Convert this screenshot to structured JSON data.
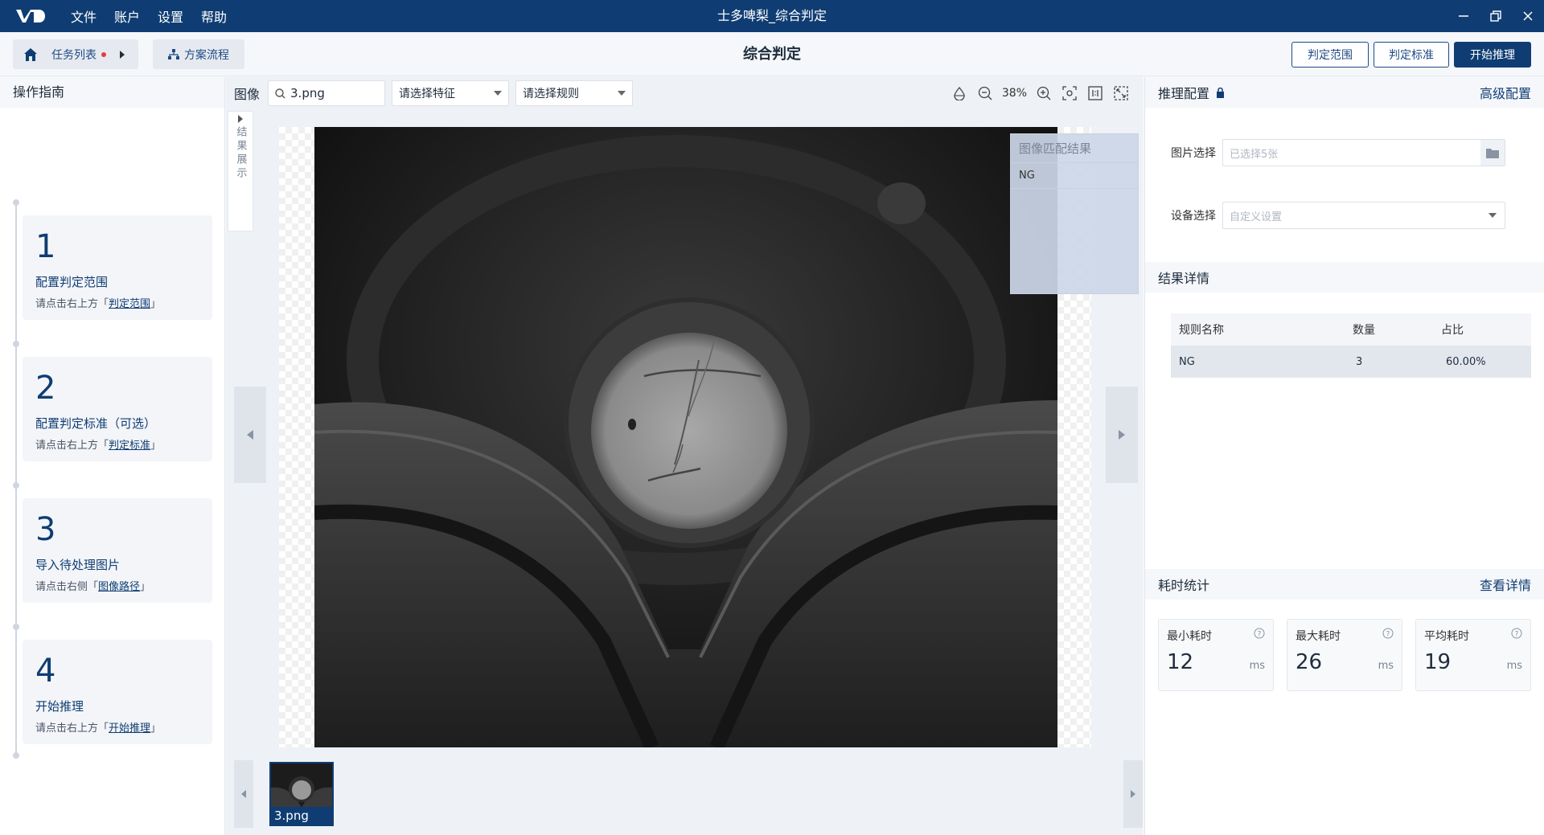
{
  "titlebar": {
    "menu": [
      "文件",
      "账户",
      "设置",
      "帮助"
    ],
    "title": "士多啤梨_综合判定"
  },
  "toolbar": {
    "task_list": "任务列表",
    "flow": "方案流程",
    "page_title": "综合判定",
    "buttons": {
      "range": "判定范围",
      "standard": "判定标准",
      "start": "开始推理"
    }
  },
  "guide": {
    "header": "操作指南",
    "steps": [
      {
        "num": "1",
        "name": "配置判定范围",
        "hint_pre": "请点击右上方「",
        "hint_link": "判定范围",
        "hint_post": "」"
      },
      {
        "num": "2",
        "name": "配置判定标准（可选）",
        "hint_pre": "请点击右上方「",
        "hint_link": "判定标准",
        "hint_post": "」"
      },
      {
        "num": "3",
        "name": "导入待处理图片",
        "hint_pre": "请点击右侧「",
        "hint_link": "图像路径",
        "hint_post": "」"
      },
      {
        "num": "4",
        "name": "开始推理",
        "hint_pre": "请点击右上方「",
        "hint_link": "开始推理",
        "hint_post": "」"
      }
    ]
  },
  "image_bar": {
    "label": "图像",
    "search_value": "3.png",
    "feature_select": "请选择特征",
    "rule_select": "请选择规则",
    "zoom": "38%"
  },
  "side_tab": "结果展示",
  "overlay": {
    "title": "图像匹配结果",
    "value": "NG"
  },
  "thumbnails": [
    {
      "name": "3.png"
    }
  ],
  "right": {
    "config_header": "推理配置",
    "advanced": "高级配置",
    "image_select_label": "图片选择",
    "image_select_value": "已选择5张",
    "device_select_label": "设备选择",
    "device_select_value": "自定义设置",
    "result_header": "结果详情",
    "table": {
      "columns": [
        "规则名称",
        "数量",
        "占比"
      ],
      "rows": [
        [
          "NG",
          "3",
          "60.00%"
        ]
      ]
    },
    "time_header": "耗时统计",
    "view_detail": "查看详情",
    "stats": [
      {
        "label": "最小耗时",
        "value": "12",
        "unit": "ms"
      },
      {
        "label": "最大耗时",
        "value": "26",
        "unit": "ms"
      },
      {
        "label": "平均耗时",
        "value": "19",
        "unit": "ms"
      }
    ]
  },
  "colors": {
    "brand": "#0f3d73",
    "alert_dot": "#e0403a"
  }
}
